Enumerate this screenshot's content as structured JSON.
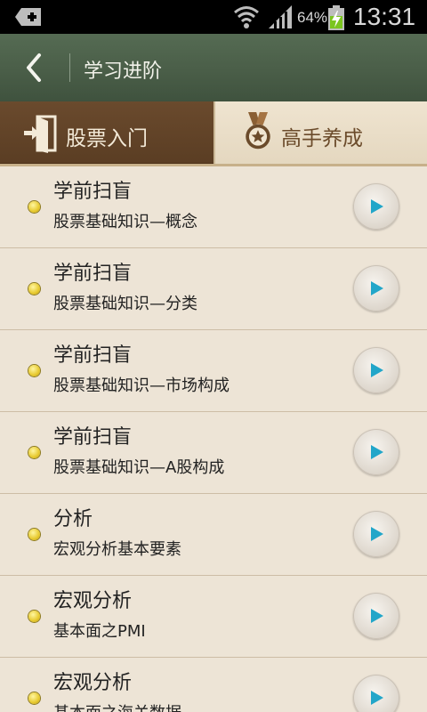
{
  "status_bar": {
    "battery_percent": "64%",
    "time": "13:31",
    "icons": [
      "notification-plus-icon",
      "wifi-icon",
      "signal-icon",
      "battery-charging-icon"
    ]
  },
  "header": {
    "title": "学习进阶",
    "back_icon": "chevron-left-icon"
  },
  "tabs": [
    {
      "label": "股票入门",
      "icon": "door-enter-icon",
      "active": true
    },
    {
      "label": "高手养成",
      "icon": "medal-star-icon",
      "active": false
    }
  ],
  "lessons": [
    {
      "title": "学前扫盲",
      "subtitle": "股票基础知识—概念"
    },
    {
      "title": "学前扫盲",
      "subtitle": "股票基础知识—分类"
    },
    {
      "title": "学前扫盲",
      "subtitle": "股票基础知识—市场构成"
    },
    {
      "title": "学前扫盲",
      "subtitle": "股票基础知识—A股构成"
    },
    {
      "title": "分析",
      "subtitle": "宏观分析基本要素"
    },
    {
      "title": "宏观分析",
      "subtitle": "基本面之PMI"
    },
    {
      "title": "宏观分析",
      "subtitle": "基本面之海关数据"
    }
  ],
  "colors": {
    "header_green": "#4a5e48",
    "tab_active_brown": "#5a3d23",
    "list_background": "#ede4d6",
    "play_triangle": "#22a6c9",
    "bullet_yellow": "#e7c92e"
  }
}
